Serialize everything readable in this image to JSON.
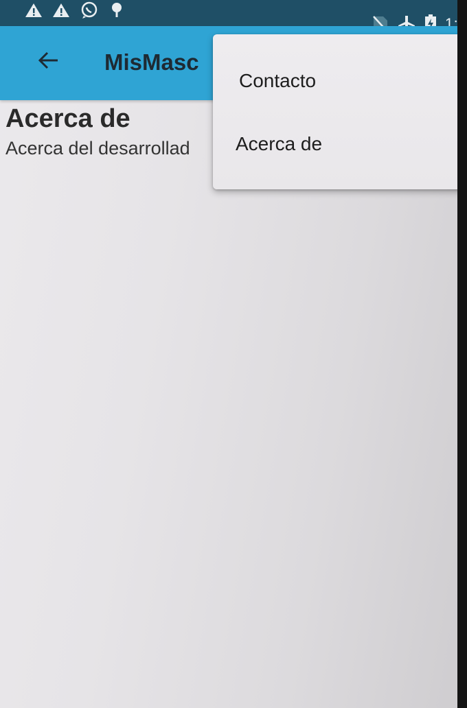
{
  "status_bar": {
    "time": "1:1",
    "left_icons": [
      "warning-icon",
      "warning-icon",
      "whatsapp-icon",
      "android-debug-icon"
    ],
    "right_icons": [
      "no-sim-icon",
      "airplane-icon",
      "battery-charging-icon"
    ]
  },
  "app_bar": {
    "title": "MisMasc",
    "back_icon": "arrow-back-icon",
    "color": "#2fa4d4"
  },
  "content": {
    "heading": "Acerca de",
    "body": "Acerca del desarrollad"
  },
  "overflow_menu": {
    "items": [
      {
        "label": "Contacto"
      },
      {
        "label": "Acerca de"
      }
    ]
  }
}
